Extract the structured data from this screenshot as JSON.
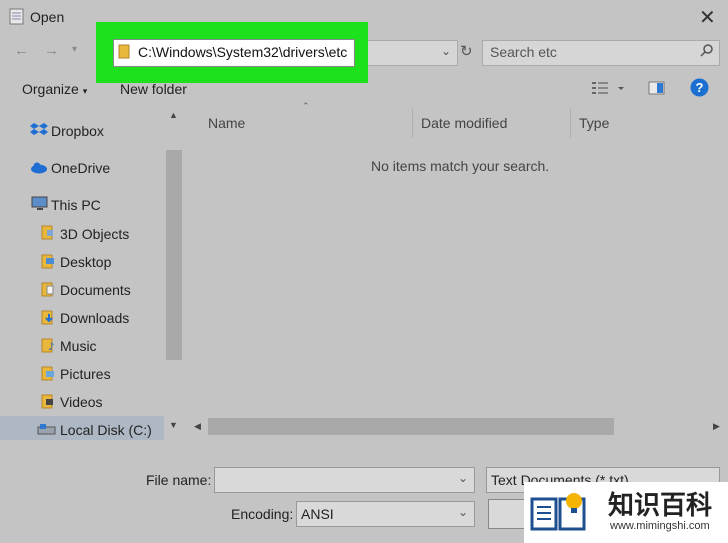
{
  "window": {
    "title": "Open"
  },
  "address": {
    "path": "C:\\Windows\\System32\\drivers\\etc"
  },
  "search": {
    "placeholder": "Search etc"
  },
  "toolbar": {
    "organize": "Organize",
    "new_folder": "New folder"
  },
  "nav": {
    "items": [
      {
        "label": "Dropbox",
        "icon": "dropbox-icon"
      },
      {
        "label": "OneDrive",
        "icon": "cloud-icon"
      },
      {
        "label": "This PC",
        "icon": "computer-icon"
      },
      {
        "label": "3D Objects",
        "icon": "folder-icon"
      },
      {
        "label": "Desktop",
        "icon": "folder-icon"
      },
      {
        "label": "Documents",
        "icon": "folder-icon"
      },
      {
        "label": "Downloads",
        "icon": "folder-icon"
      },
      {
        "label": "Music",
        "icon": "folder-icon"
      },
      {
        "label": "Pictures",
        "icon": "folder-icon"
      },
      {
        "label": "Videos",
        "icon": "folder-icon"
      },
      {
        "label": "Local Disk (C:)",
        "icon": "drive-icon"
      }
    ]
  },
  "columns": {
    "name": "Name",
    "date_modified": "Date modified",
    "type": "Type"
  },
  "content": {
    "empty_message": "No items match your search."
  },
  "bottom": {
    "file_name_label": "File name:",
    "file_name_value": "",
    "file_type": "Text Documents (*.txt)",
    "encoding_label": "Encoding:",
    "encoding_value": "ANSI"
  },
  "logo": {
    "name": "知识百科",
    "url": "www.mimingshi.com"
  },
  "colors": {
    "highlight": "#1ee11e",
    "background": "#c4c4c4",
    "help_icon": "#1a6fd1",
    "dropbox": "#1f6ed4"
  }
}
